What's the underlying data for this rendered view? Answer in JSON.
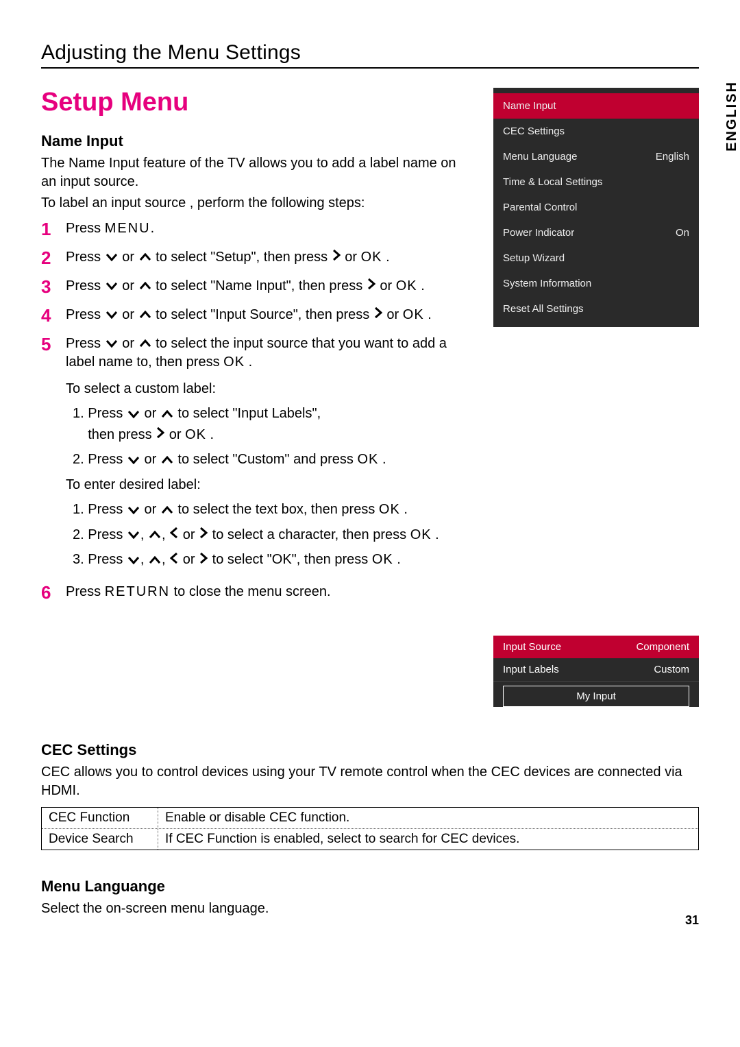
{
  "header": "Adjusting the Menu Settings",
  "mainTitle": "Setup Menu",
  "nameInput": {
    "title": "Name Input",
    "desc1": "The Name Input feature of the TV allows you to add a label name on an input source.",
    "desc2": "To label an input source , perform the following steps:"
  },
  "steps": {
    "s1": {
      "num": "1",
      "text_a": "Press ",
      "menu": "MENU",
      "text_b": "."
    },
    "s2": {
      "num": "2",
      "text_a": "Press ",
      "text_b": " or ",
      "text_c": " to select \"Setup\", then press ",
      "text_d": " or ",
      "ok": "OK",
      "text_e": " ."
    },
    "s3": {
      "num": "3",
      "text_a": "Press ",
      "text_b": " or ",
      "text_c": " to select \"Name Input\", then press ",
      "text_d": " or ",
      "ok": "OK",
      "text_e": " ."
    },
    "s4": {
      "num": "4",
      "text_a": "Press ",
      "text_b": " or ",
      "text_c": " to select \"Input Source\", then press ",
      "text_d": " or ",
      "ok": "OK",
      "text_e": " ."
    },
    "s5": {
      "num": "5",
      "text_a": "Press ",
      "text_b": " or ",
      "text_c": " to select the input source that you want to add a label name to, then press ",
      "ok": "OK",
      "text_d": " ."
    },
    "s6": {
      "num": "6",
      "text_a": "Press ",
      "return": "RETURN",
      "text_b": " to close the menu screen."
    }
  },
  "sub": {
    "customTitle": "To select a custom label:",
    "c1_a": "1. Press ",
    "c1_b": " or ",
    "c1_c": " to select \"Input Labels\",",
    "c1_d": "then press ",
    "c1_e": " or ",
    "c1_ok": "OK",
    "c1_f": " .",
    "c2_a": "2. Press ",
    "c2_b": " or ",
    "c2_c": " to select \"Custom\" and press ",
    "c2_ok": "OK",
    "c2_d": " .",
    "desiredTitle": "To enter desired label:",
    "d1_a": "1. Press ",
    "d1_b": " or ",
    "d1_c": " to select the text box, then press ",
    "d1_ok": "OK",
    "d1_d": " .",
    "d2_a": "2. Press ",
    "d2_b": ", ",
    "d2_c": ", ",
    "d2_d": " or ",
    "d2_e": " to select a character, then press ",
    "d2_ok": "OK",
    "d2_f": " .",
    "d3_a": "3. Press ",
    "d3_b": ", ",
    "d3_c": ", ",
    "d3_d": " or ",
    "d3_e": " to select \"OK\", then press ",
    "d3_ok": "OK",
    "d3_f": " ."
  },
  "menuPanel": {
    "items": [
      {
        "label": "Name Input",
        "value": "",
        "active": true
      },
      {
        "label": "CEC Settings",
        "value": ""
      },
      {
        "label": "Menu Language",
        "value": "English"
      },
      {
        "label": "Time & Local Settings",
        "value": ""
      },
      {
        "label": "Parental Control",
        "value": ""
      },
      {
        "label": "Power Indicator",
        "value": "On"
      },
      {
        "label": "Setup Wizard",
        "value": ""
      },
      {
        "label": "System Information",
        "value": ""
      },
      {
        "label": "Reset All Settings",
        "value": ""
      }
    ]
  },
  "inputPanel": {
    "row1": {
      "label": "Input Source",
      "value": "Component",
      "active": true
    },
    "row2": {
      "label": "Input Labels",
      "value": "Custom"
    },
    "textbox": "My Input"
  },
  "langTab": "ENGLISH",
  "cec": {
    "title": "CEC Settings",
    "desc": "CEC allows you to control devices using your TV remote control when the CEC devices are connected via HDMI.",
    "rows": [
      {
        "l": "CEC Function",
        "r": "Enable or disable CEC function."
      },
      {
        "l": "Device Search",
        "r": "If CEC Function is enabled, select to search for CEC devices."
      }
    ]
  },
  "menuLang": {
    "title": "Menu Languange",
    "desc": "Select the on-screen menu language."
  },
  "pageNum": "31"
}
